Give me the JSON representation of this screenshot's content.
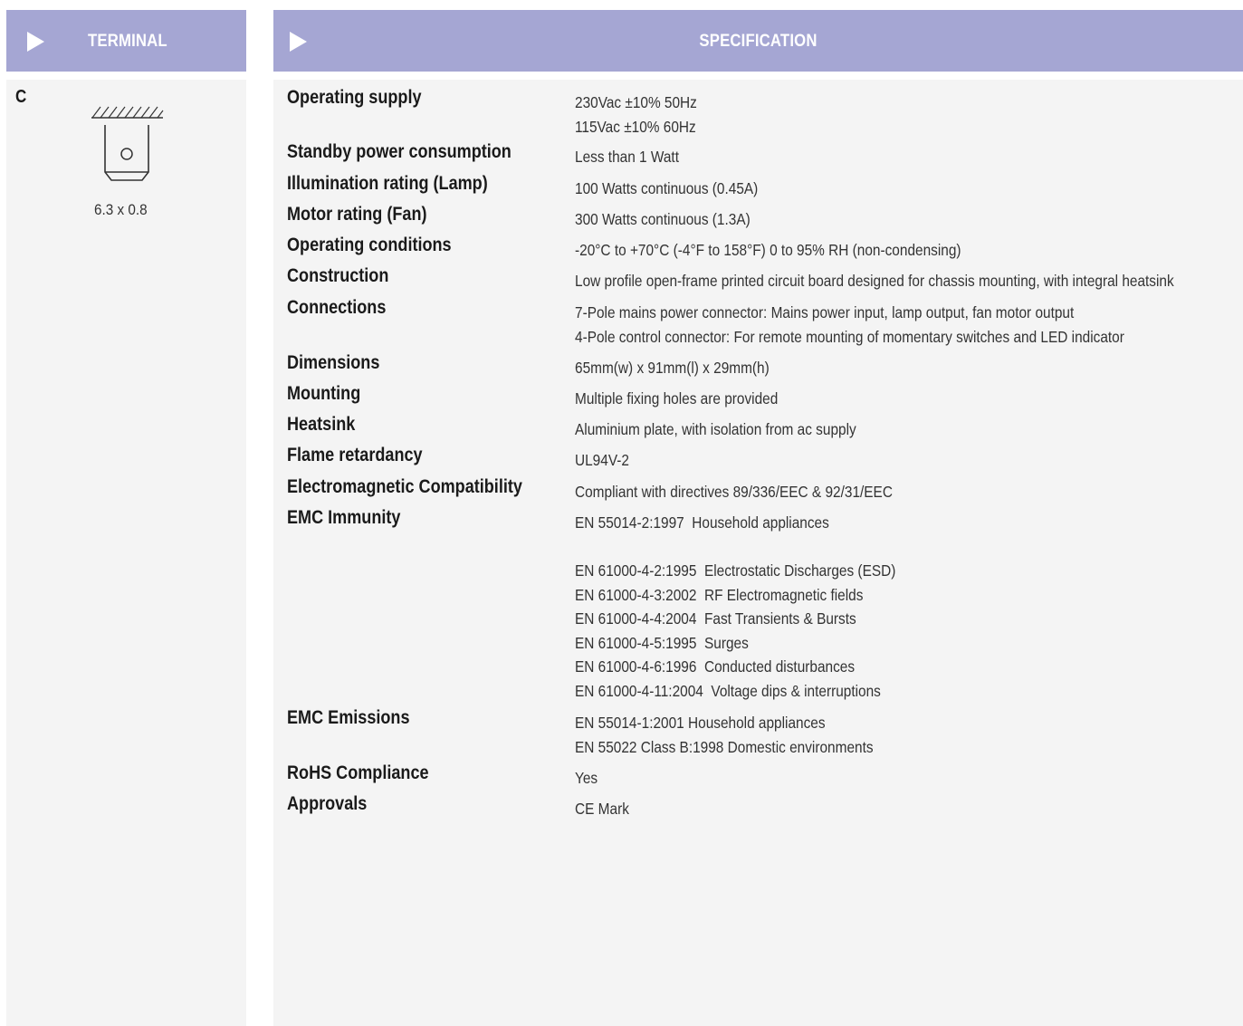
{
  "terminal": {
    "header": "TERMINAL",
    "code": "C",
    "size": "6.3 x 0.8"
  },
  "specification": {
    "header": "SPECIFICATION",
    "rows": [
      {
        "label": "Operating supply",
        "values": [
          "230Vac ±10% 50Hz",
          "115Vac ±10% 60Hz"
        ]
      },
      {
        "label": "Standby power consumption",
        "values": [
          "Less than 1 Watt"
        ]
      },
      {
        "label": "Illumination rating (Lamp)",
        "values": [
          "100 Watts continuous (0.45A)"
        ]
      },
      {
        "label": "Motor rating (Fan)",
        "values": [
          "300 Watts continuous (1.3A)"
        ]
      },
      {
        "label": "Operating conditions",
        "values": [
          "-20°C to +70°C (-4°F to 158°F) 0 to 95% RH (non-condensing)"
        ]
      },
      {
        "label": "Construction",
        "values": [
          "Low profile open-frame printed circuit board designed for chassis mounting, with integral heatsink"
        ]
      },
      {
        "label": "Connections",
        "values": [
          "7-Pole mains power connector: Mains power input, lamp output, fan motor output",
          "4-Pole control connector: For remote mounting of momentary switches and LED indicator"
        ]
      },
      {
        "label": "Dimensions",
        "values": [
          "65mm(w) x 91mm(l) x 29mm(h)"
        ]
      },
      {
        "label": "Mounting",
        "values": [
          "Multiple fixing holes are provided"
        ]
      },
      {
        "label": "Heatsink",
        "values": [
          "Aluminium plate, with isolation from ac supply"
        ]
      },
      {
        "label": "Flame retardancy",
        "values": [
          "UL94V-2"
        ]
      },
      {
        "label": "Electromagnetic Compatibility",
        "values": [
          "Compliant with directives 89/336/EEC & 92/31/EEC"
        ]
      },
      {
        "label": "EMC Immunity",
        "values": [
          "EN 55014-2:1997  Household appliances",
          "",
          "EN 61000-4-2:1995  Electrostatic Discharges (ESD)",
          "EN 61000-4-3:2002  RF Electromagnetic fields",
          "EN 61000-4-4:2004  Fast Transients & Bursts",
          "EN 61000-4-5:1995  Surges",
          "EN 61000-4-6:1996  Conducted disturbances",
          "EN 61000-4-11:2004  Voltage dips & interruptions"
        ]
      },
      {
        "label": "EMC Emissions",
        "values": [
          "EN 55014-1:2001 Household appliances",
          "EN 55022 Class B:1998 Domestic environments"
        ]
      },
      {
        "label": "RoHS Compliance",
        "values": [
          "Yes"
        ]
      },
      {
        "label": "Approvals",
        "values": [
          "CE Mark"
        ]
      }
    ]
  }
}
